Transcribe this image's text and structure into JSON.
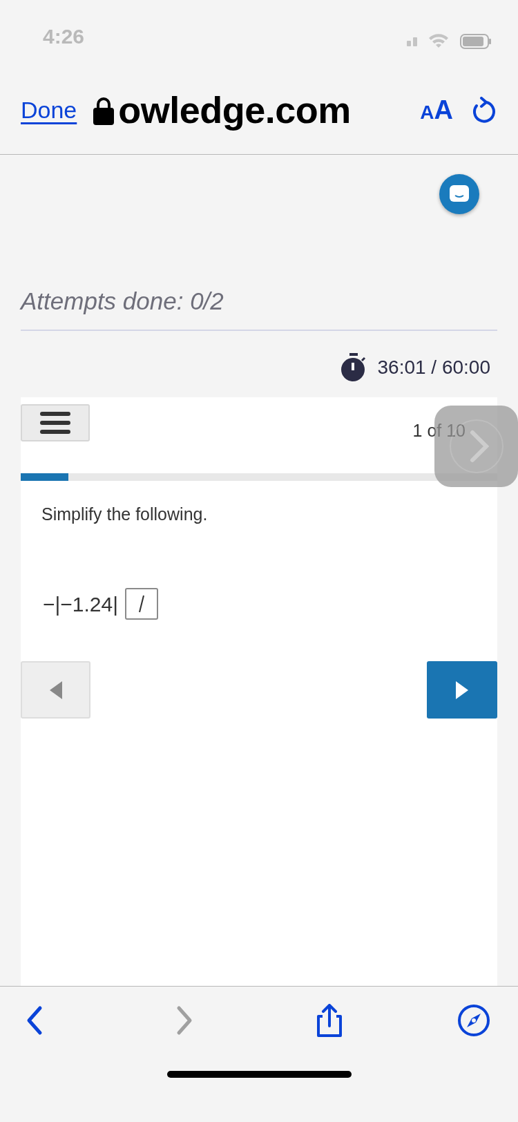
{
  "status_bar": {
    "time": "4:26"
  },
  "browser_bar": {
    "done": "Done",
    "url": "owledge.com",
    "text_size": "AA"
  },
  "quiz": {
    "attempts": "Attempts done: 0/2",
    "timer": "36:01 / 60:00",
    "counter": "1 of 10",
    "progress": {
      "level": 0.1
    },
    "question": {
      "prompt": "Simplify the following.",
      "expression": "−|−1.24|"
    }
  },
  "toolbar": [
    {
      "kind": "back",
      "disabled": false
    },
    {
      "kind": "forward",
      "disabled": true
    },
    {
      "kind": "share",
      "disabled": false
    },
    {
      "kind": "compass",
      "disabled": false
    }
  ]
}
